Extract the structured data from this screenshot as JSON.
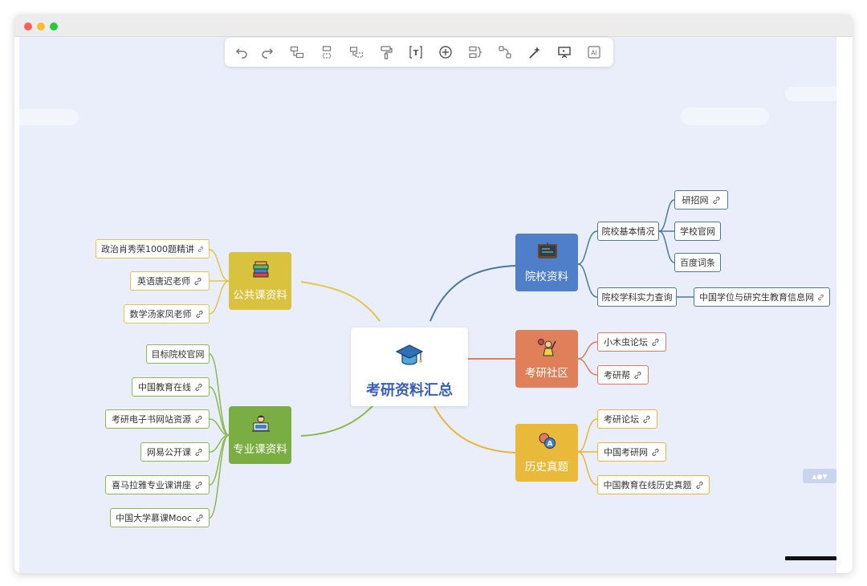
{
  "toolbar": {
    "tools": [
      {
        "name": "undo-icon"
      },
      {
        "name": "redo-icon"
      },
      {
        "name": "subtopic-icon"
      },
      {
        "name": "sibling-topic-icon"
      },
      {
        "name": "parent-topic-icon"
      },
      {
        "name": "format-painter-icon"
      },
      {
        "name": "text-icon"
      },
      {
        "name": "insert-icon"
      },
      {
        "name": "summary-icon"
      },
      {
        "name": "relationship-icon"
      },
      {
        "name": "magic-wand-icon"
      },
      {
        "name": "presentation-icon"
      },
      {
        "name": "ai-icon"
      }
    ],
    "ai_label": "AI",
    "text_label": "T"
  },
  "mindmap": {
    "central": {
      "label": "考研资料汇总",
      "color": "#3a5db8"
    },
    "topics": {
      "public": {
        "label": "公共课资料",
        "color": "#d9c23e",
        "line": "#e2c64a",
        "leaves": [
          "政治肖秀荣1000题精讲",
          "英语唐迟老师",
          "数学汤家凤老师"
        ]
      },
      "major": {
        "label": "专业课资料",
        "color": "#7aae42",
        "line": "#8bb84f",
        "leaves": [
          "目标院校官网",
          "中国教育在线",
          "考研电子书网站资源",
          "网易公开课",
          "喜马拉雅专业课讲座",
          "中国大学慕课Mooc"
        ]
      },
      "school": {
        "label": "院校资料",
        "color": "#4e7fc8",
        "line": "#4c7a94",
        "children": [
          {
            "label": "院校基本情况",
            "children": [
              "研招网",
              "学校官网",
              "百度词条"
            ]
          },
          {
            "label": "院校学科实力查询",
            "children": [
              "中国学位与研究生教育信息网"
            ]
          }
        ]
      },
      "community": {
        "label": "考研社区",
        "color": "#e0805a",
        "line": "#e07b5d",
        "leaves": [
          "小木虫论坛",
          "考研帮"
        ]
      },
      "exam": {
        "label": "历史真题",
        "color": "#e9b93a",
        "line": "#e6b73c",
        "leaves": [
          "考研论坛",
          "中国考研网",
          "中国教育在线历史真题"
        ]
      }
    }
  },
  "nav_badge": "▲●▼"
}
